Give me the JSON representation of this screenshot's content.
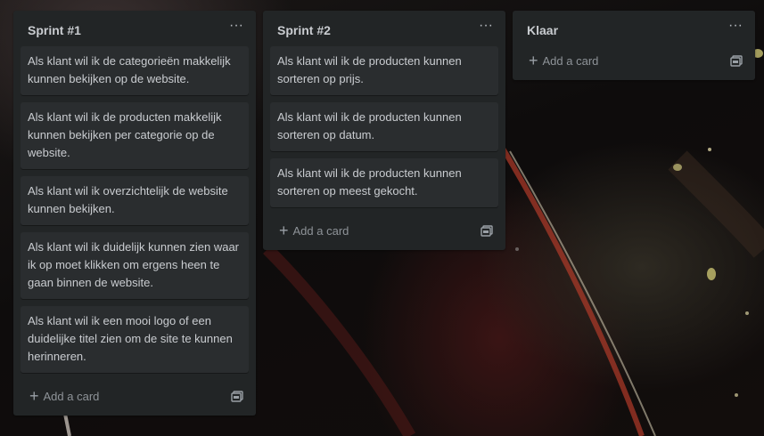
{
  "lists": [
    {
      "title": "Sprint #1",
      "menu_label": "···",
      "cards": [
        "Als klant wil ik de categorieën makkelijk kunnen bekijken op de website.",
        "Als klant wil ik de producten makkelijk kunnen bekijken per categorie op de website.",
        "Als klant wil ik overzichtelijk de website kunnen bekijken.",
        "Als klant wil ik duidelijk kunnen zien waar ik op moet klikken om ergens heen te gaan binnen de website.",
        "Als klant wil ik een mooi logo of een duidelijke titel zien om de site te kunnen herinneren."
      ],
      "add_card_label": "Add a card"
    },
    {
      "title": "Sprint #2",
      "menu_label": "···",
      "cards": [
        "Als klant wil ik de producten kunnen sorteren op prijs.",
        "Als klant wil ik de producten kunnen sorteren op datum.",
        "Als klant wil ik de producten kunnen sorteren op meest gekocht."
      ],
      "add_card_label": "Add a card"
    },
    {
      "title": "Klaar",
      "menu_label": "···",
      "cards": [],
      "add_card_label": "Add a card"
    }
  ],
  "icons": {
    "menu": "ellipsis-icon",
    "add": "plus-icon",
    "template": "card-template-icon"
  },
  "colors": {
    "list_bg": "#222526",
    "card_bg": "#2a2d2f",
    "text": "#c9ccd0",
    "muted": "#8e9398"
  }
}
